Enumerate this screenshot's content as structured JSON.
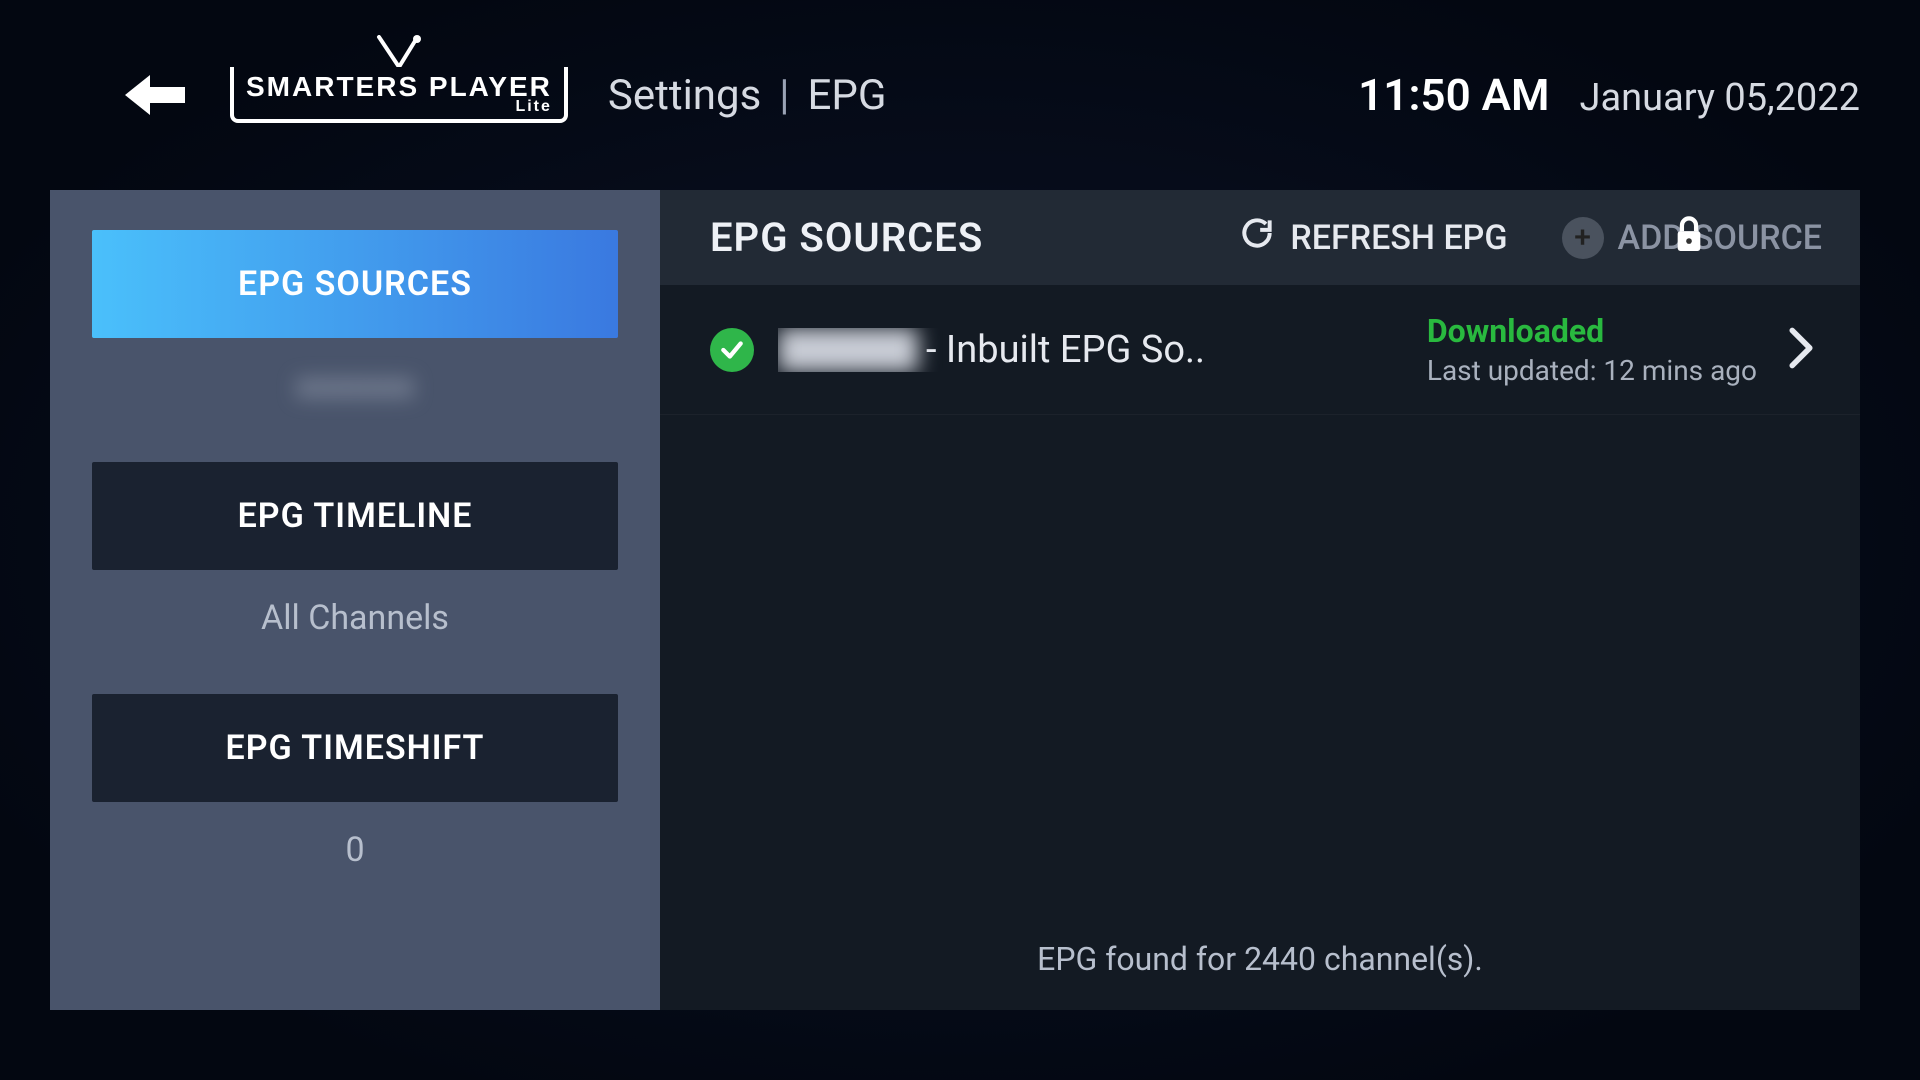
{
  "header": {
    "logo_main": "SMARTERS PLAYER",
    "logo_sub": "Lite",
    "breadcrumb": [
      "Settings",
      "EPG"
    ],
    "separator": "|",
    "time": "11:50 AM",
    "date": "January 05,2022"
  },
  "sidebar": {
    "items": [
      {
        "label": "EPG SOURCES",
        "sub": "",
        "active": true,
        "sub_blurred": true
      },
      {
        "label": "EPG TIMELINE",
        "sub": "All Channels",
        "active": false
      },
      {
        "label": "EPG TIMESHIFT",
        "sub": "0",
        "active": false
      }
    ]
  },
  "content": {
    "title": "EPG SOURCES",
    "refresh_label": "REFRESH EPG",
    "add_label": "ADD SOURCE",
    "sources": [
      {
        "name_suffix": "- Inbuilt EPG So..",
        "status": "Downloaded",
        "updated": "Last updated: 12 mins ago"
      }
    ],
    "footer": "EPG found for 2440 channel(s)."
  }
}
